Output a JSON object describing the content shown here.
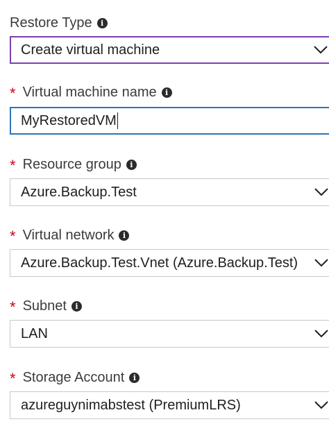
{
  "fields": [
    {
      "label": "Restore Type",
      "required": false,
      "value": "Create virtual machine",
      "kind": "select",
      "icon": "info-icon"
    },
    {
      "label": "Virtual machine name",
      "required": true,
      "value": "MyRestoredVM",
      "kind": "input",
      "icon": "info-icon"
    },
    {
      "label": "Resource group",
      "required": true,
      "value": "Azure.Backup.Test",
      "kind": "select",
      "icon": "info-icon"
    },
    {
      "label": "Virtual network",
      "required": true,
      "value": "Azure.Backup.Test.Vnet (Azure.Backup.Test)",
      "kind": "select",
      "icon": "info-icon"
    },
    {
      "label": "Subnet",
      "required": true,
      "value": "LAN",
      "kind": "select",
      "icon": "info-icon"
    },
    {
      "label": "Storage Account",
      "required": true,
      "value": "azureguynimabstest (PremiumLRS)",
      "kind": "select",
      "icon": "info-icon"
    }
  ],
  "required_marker": "*",
  "info_glyph": "i",
  "colors": {
    "required": "#d0021b",
    "focus_select_border": "#7b3fb2",
    "focus_input_border": "#2d74b8",
    "default_border": "#c8c8c8"
  }
}
